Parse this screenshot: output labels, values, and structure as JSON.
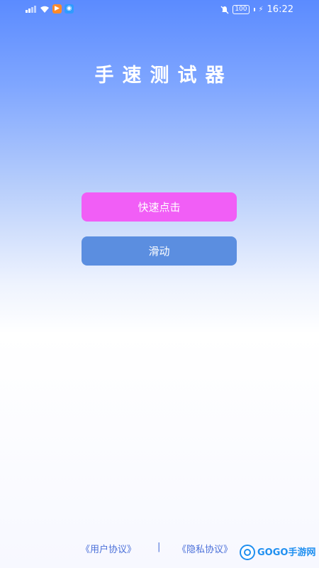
{
  "status_bar": {
    "time": "16:22",
    "battery": "100"
  },
  "app": {
    "title": "手速测试器"
  },
  "buttons": {
    "fast_click": "快速点击",
    "slide": "滑动"
  },
  "footer": {
    "user_agreement": "《用户协议》",
    "divider": "|",
    "privacy_agreement": "《隐私协议》"
  },
  "watermark": {
    "text": "GOGO手游网"
  },
  "colors": {
    "fast_click_button": "#f15ef6",
    "slide_button": "#5b8ee0",
    "link": "#4a6fd9"
  }
}
